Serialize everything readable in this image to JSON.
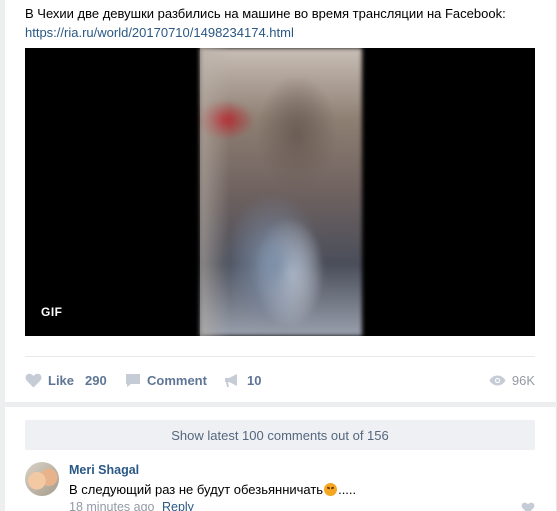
{
  "post": {
    "text": "В Чехии две девушки разбились на машине во время трансляции на Facebook:",
    "link": "https://ria.ru/world/20170710/1498234174.html",
    "media_badge": "GIF"
  },
  "actions": {
    "like_label": "Like",
    "like_count": "290",
    "comment_label": "Comment",
    "share_count": "10",
    "views_count": "96K"
  },
  "comments": {
    "show_more": "Show latest 100 comments out of 156",
    "items": [
      {
        "author": "Meri Shagal",
        "text_before": "В следующий раз не будут обезьянничать",
        "emoji": "angry-face-emoji",
        "text_after": ".....",
        "time": "18 minutes ago",
        "reply_label": "Reply"
      }
    ]
  },
  "colors": {
    "link": "#2a5885",
    "muted": "#939aa5",
    "background": "#edeef0",
    "card": "#ffffff"
  }
}
